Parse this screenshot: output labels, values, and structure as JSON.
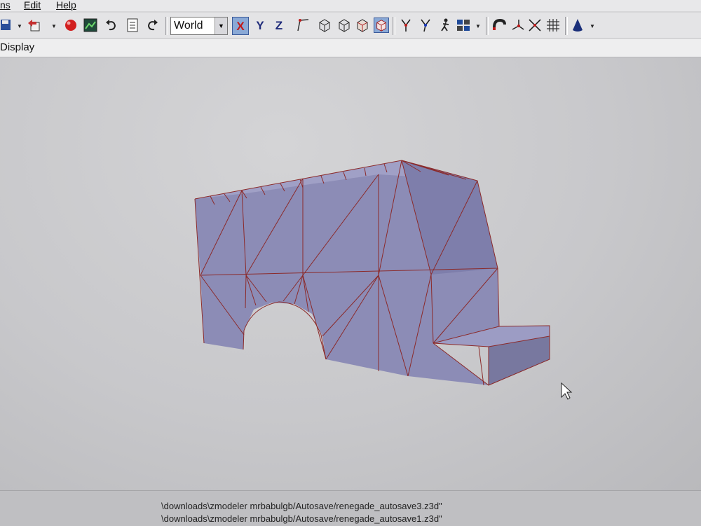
{
  "menu": {
    "items": [
      "ns",
      "Edit",
      "Help"
    ]
  },
  "toolbar": {
    "coordinate_system": "World",
    "axes": [
      "X",
      "Y",
      "Z"
    ],
    "active_axis": "X",
    "icons": [
      "save-icon",
      "undo-history-icon",
      "render-sphere-icon",
      "image-icon",
      "undo-icon",
      "document-icon",
      "redo-icon",
      "select-vertex-icon",
      "cube-select-icon",
      "cube-select-2-icon",
      "cube-move-icon",
      "cube-rotate-icon",
      "pin-icon",
      "pin-2-icon",
      "figure-icon",
      "group-icon",
      "magnet-icon",
      "vertex-tool-icon",
      "cross-tool-icon",
      "grid-icon",
      "cone-icon"
    ]
  },
  "tabs": {
    "active_label": "Display"
  },
  "viewport": {
    "mesh_fill": "#8a8ab4",
    "edge_color": "#8b2a2a",
    "background": "#c9c9cc"
  },
  "status": {
    "lines": [
      "\\downloads\\zmodeler mrbabulgb/Autosave/renegade_autosave3.z3d\"",
      "\\downloads\\zmodeler mrbabulgb/Autosave/renegade_autosave1.z3d\""
    ]
  }
}
